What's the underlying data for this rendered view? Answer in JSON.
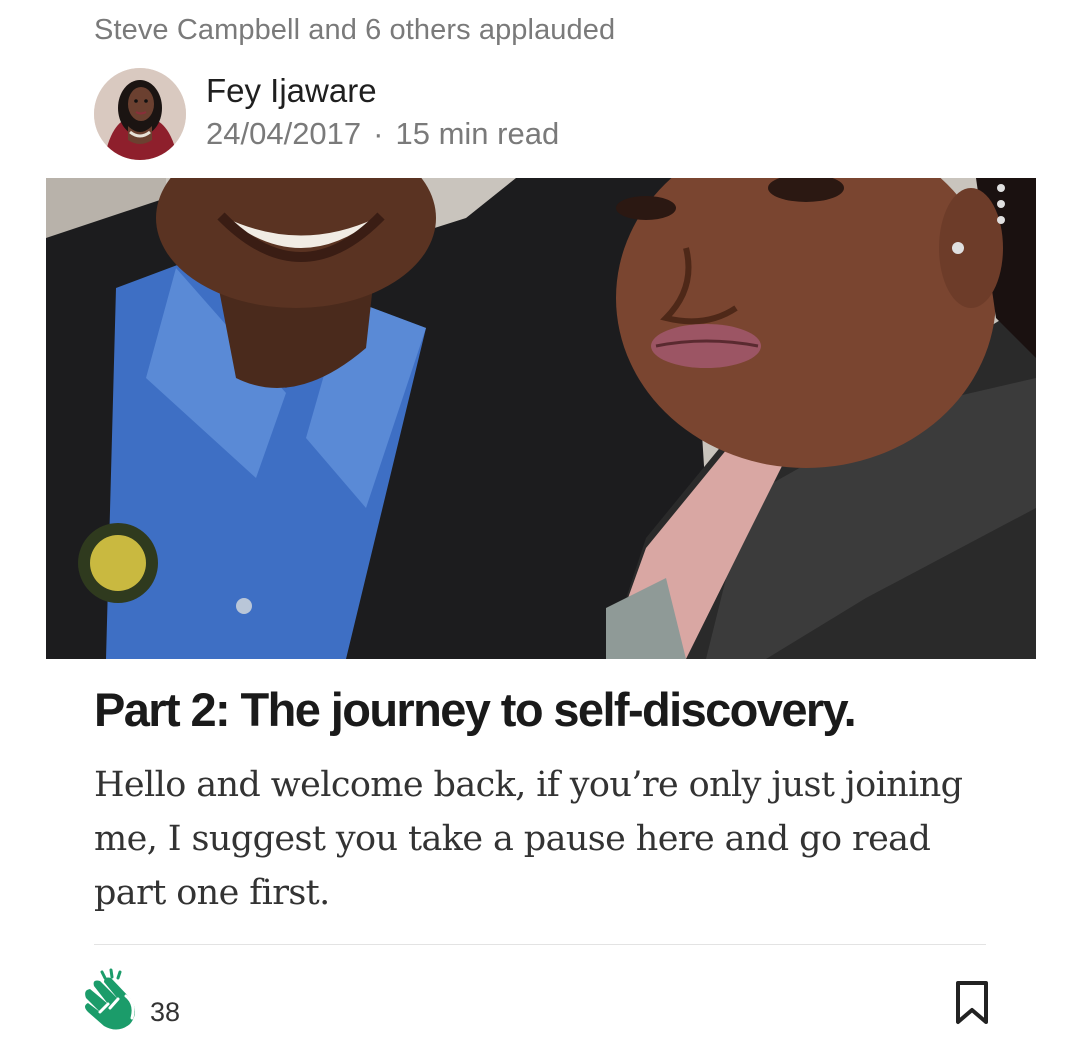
{
  "feed_item": {
    "social_context": "Steve Campbell and 6 others applauded",
    "author": {
      "name": "Fey Ijaware",
      "date": "24/04/2017",
      "separator": "·",
      "read_time": "15 min read"
    },
    "title": "Part 2: The journey to self-discovery.",
    "excerpt": "Hello and welcome back, if you’re only just joining me, I suggest you take a pause here and go read part one first.",
    "claps": {
      "count": "38",
      "icon": "clap-icon"
    },
    "bookmark_icon": "bookmark-icon"
  },
  "colors": {
    "accent_green": "#1a8917",
    "clap_green": "#1b9c6a",
    "meta_gray": "#7a7a7a"
  }
}
